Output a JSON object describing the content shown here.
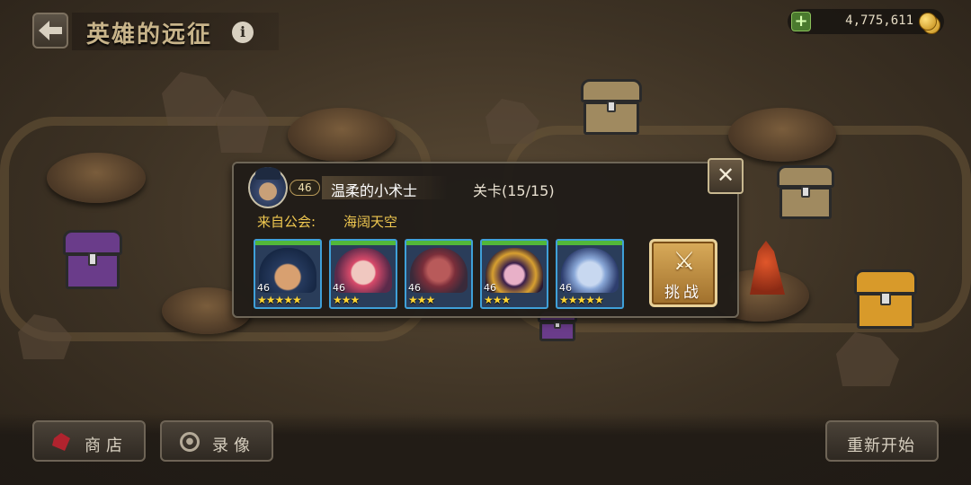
{
  "header": {
    "title": "英雄的远征",
    "info_symbol": "i",
    "gold": "4,775,611",
    "add_symbol": "+"
  },
  "popup": {
    "player_level": "46",
    "player_name": "温柔的小术士",
    "stage_label": "关卡(15/15)",
    "guild_label": "来自公会:",
    "guild_name": "海阔天空",
    "close_symbol": "✕",
    "challenge_label": "挑战",
    "heroes": [
      {
        "level": "46",
        "stars": "★★★★★",
        "star_count": 5
      },
      {
        "level": "46",
        "stars": "★★★",
        "star_count": 3
      },
      {
        "level": "46",
        "stars": "★★★",
        "star_count": 3
      },
      {
        "level": "46",
        "stars": "★★★",
        "star_count": 3
      },
      {
        "level": "46",
        "stars": "★★★★★",
        "star_count": 5
      }
    ]
  },
  "bottom": {
    "shop_label": "商店",
    "replay_label": "录像",
    "restart_label": "重新开始"
  },
  "icons": [
    "back-arrow-icon",
    "info-icon",
    "add-gold-icon",
    "coin-icon",
    "close-icon",
    "swords-icon",
    "shop-icon",
    "replay-icon"
  ],
  "colors": {
    "gold_text": "#f0c850",
    "hero_frame": "#3fa0d8",
    "hp_bar": "#52b83a",
    "challenge_button": "#c8943e"
  }
}
